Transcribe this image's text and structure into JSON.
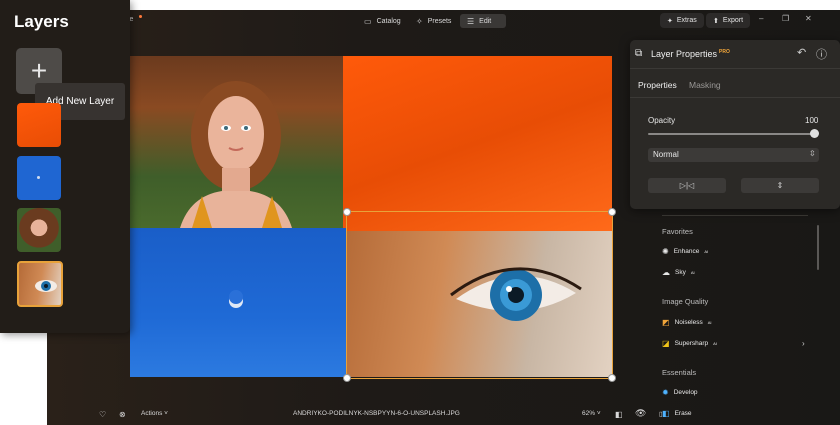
{
  "layers_panel": {
    "title": "Layers",
    "add_tooltip": "Add New Layer",
    "add_symbol": "+",
    "thumbnails": [
      {
        "name": "orange-fabric"
      },
      {
        "name": "blue-sky-moon"
      },
      {
        "name": "woman-portrait"
      },
      {
        "name": "eye-closeup",
        "selected": true
      }
    ]
  },
  "topbar": {
    "doc_partial": "ble",
    "modes": [
      {
        "label": "Catalog",
        "icon": "folder-icon"
      },
      {
        "label": "Presets",
        "icon": "sparkle-icon"
      },
      {
        "label": "Edit",
        "icon": "sliders-icon",
        "active": true
      }
    ],
    "extras_label": "Extras",
    "export_label": "Export",
    "window_controls": [
      "–",
      "❐",
      "✕"
    ]
  },
  "properties": {
    "title": "Layer Properties",
    "badge": "PRO",
    "tabs": [
      {
        "label": "Properties",
        "active": true
      },
      {
        "label": "Masking"
      }
    ],
    "opacity_label": "Opacity",
    "opacity_value": "100",
    "blend_mode": "Normal",
    "flip_horizontal_icon": "▷|◁",
    "flip_vertical_icon": "⇕"
  },
  "right_panel": {
    "sections": [
      {
        "heading": "Favorites",
        "items": [
          {
            "label": "Enhance",
            "sup": "AI",
            "icon": "sparkle-icon"
          },
          {
            "label": "Sky",
            "sup": "AI",
            "icon": "cloud-icon"
          }
        ]
      },
      {
        "heading": "Image Quality",
        "items": [
          {
            "label": "Noiseless",
            "sup": "AI",
            "icon": "noiseless-icon"
          },
          {
            "label": "Supersharp",
            "sup": "AI",
            "icon": "supersharp-icon"
          }
        ]
      },
      {
        "heading": "Essentials",
        "items": [
          {
            "label": "Develop",
            "icon": "sun-icon"
          },
          {
            "label": "Erase",
            "icon": "eraser-icon"
          }
        ]
      }
    ]
  },
  "bottombar": {
    "actions_label": "Actions",
    "filename": "ANDRIYKO-PODILNYK-NSBPYYN-6-O-UNSPLASH.JPG",
    "zoom": "62%"
  },
  "colors": {
    "accent": "#e8a23a",
    "app_bg": "#1b1917",
    "panel_bg": "#2b2926"
  }
}
